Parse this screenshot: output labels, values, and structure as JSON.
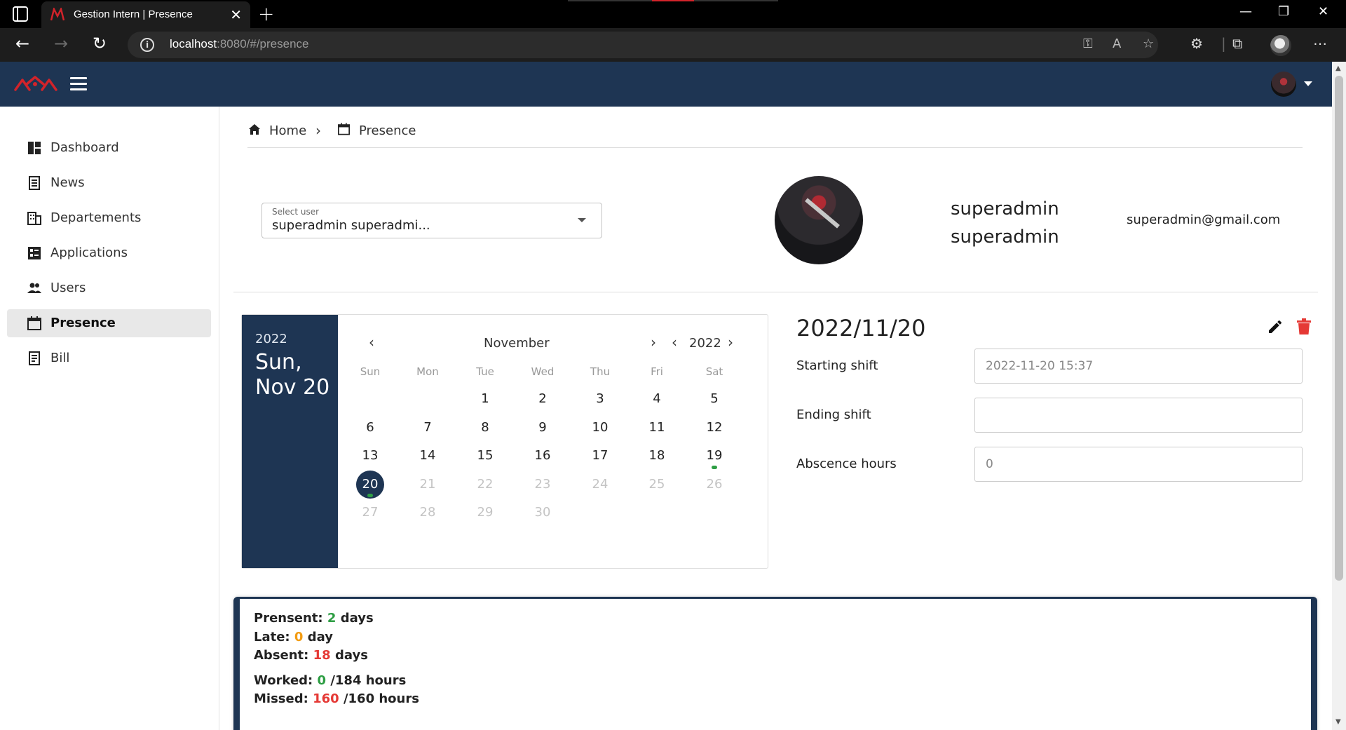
{
  "browser": {
    "tab_title": "Gestion Intern | Presence",
    "url_host": "localhost",
    "url_path": ":8080/#/presence"
  },
  "sidebar": {
    "items": [
      {
        "label": "Dashboard",
        "icon": "dashboard-icon"
      },
      {
        "label": "News",
        "icon": "news-icon"
      },
      {
        "label": "Departements",
        "icon": "building-icon"
      },
      {
        "label": "Applications",
        "icon": "applications-icon"
      },
      {
        "label": "Users",
        "icon": "users-icon"
      },
      {
        "label": "Presence",
        "icon": "calendar-icon",
        "active": true
      },
      {
        "label": "Bill",
        "icon": "bill-icon"
      }
    ]
  },
  "breadcrumb": {
    "home": "Home",
    "current": "Presence"
  },
  "user_select": {
    "label": "Select user",
    "value": "superadmin superadmi..."
  },
  "profile": {
    "first_name": "superadmin",
    "last_name": "superadmin",
    "email": "superadmin@gmail.com"
  },
  "calendar": {
    "side_year": "2022",
    "side_date": "Sun, Nov 20",
    "month": "November",
    "year": "2022",
    "weekdays": [
      "Sun",
      "Mon",
      "Tue",
      "Wed",
      "Thu",
      "Fri",
      "Sat"
    ],
    "first_weekday_index": 2,
    "days_in_month": 30,
    "selected_day": 20,
    "last_enabled_day": 20,
    "days_with_presence": [
      19,
      20
    ]
  },
  "day_detail": {
    "date": "2022/11/20",
    "starting_shift_label": "Starting shift",
    "starting_shift_value": "2022-11-20  15:37",
    "ending_shift_label": "Ending shift",
    "ending_shift_value": "",
    "absence_label": "Abscence hours",
    "absence_value": "0"
  },
  "stats": {
    "present_label": "Prensent:",
    "present_value": "2",
    "present_unit": "days",
    "late_label": "Late:",
    "late_value": "0",
    "late_unit": "day",
    "absent_label": "Absent:",
    "absent_value": "18",
    "absent_unit": "days",
    "worked_label": "Worked:",
    "worked_value": "0",
    "worked_total": "/184 hours",
    "missed_label": "Missed:",
    "missed_value": "160",
    "missed_total": "/160 hours"
  },
  "colors": {
    "primary": "#1e3553",
    "green": "#2e9e44",
    "orange": "#f39c12",
    "red": "#e53935"
  }
}
